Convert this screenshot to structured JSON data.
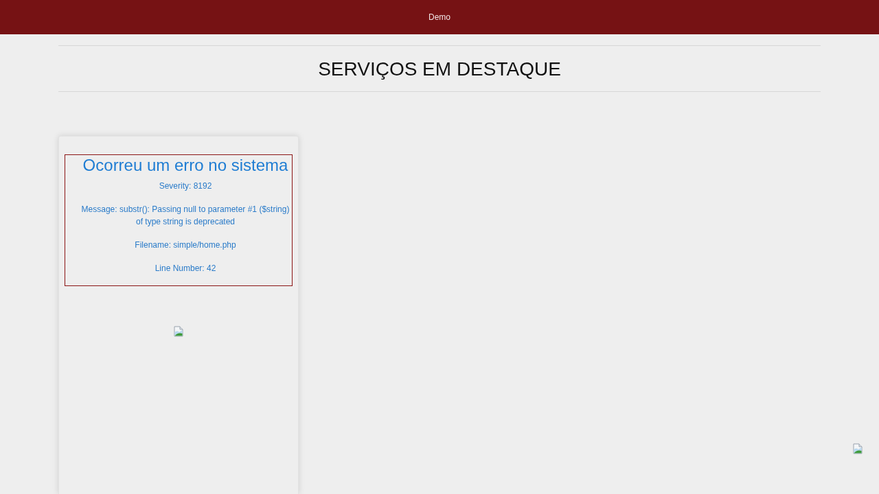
{
  "top_bar": {
    "title": "Demo"
  },
  "section": {
    "heading": "SERVIÇOS EM DESTAQUE"
  },
  "cards": [
    {
      "error": {
        "title": "Ocorreu um erro no sistema",
        "lines": [
          "Severity: 8192",
          "Message: substr(): Passing null to parameter #1 ($string) of type string is deprecated",
          "Filename: simple/home.php",
          "Line Number: 42"
        ]
      }
    }
  ]
}
